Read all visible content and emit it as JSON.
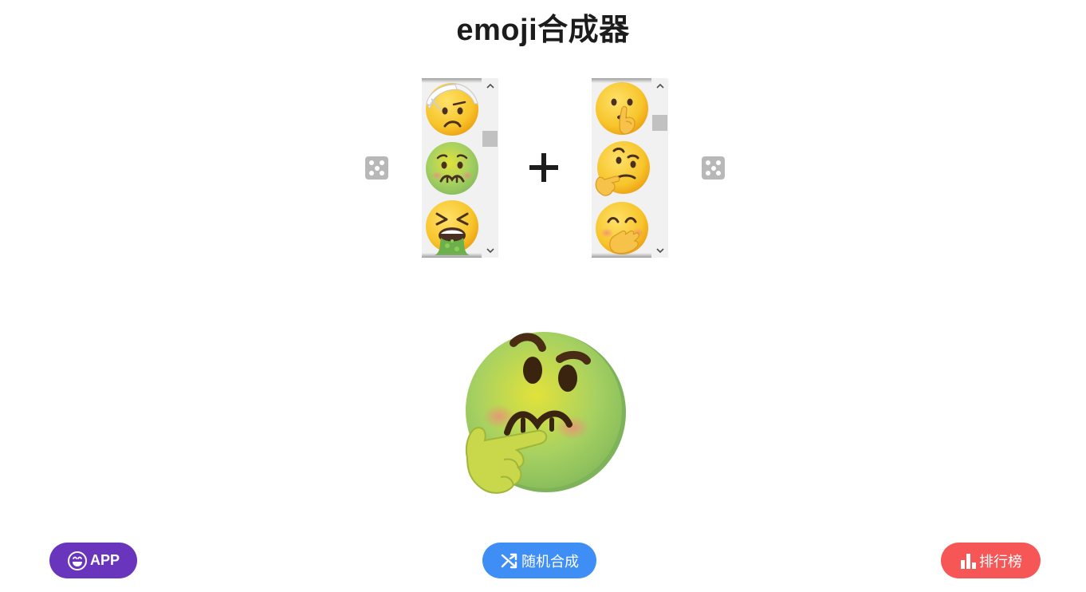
{
  "page": {
    "title": "emoji合成器"
  },
  "picker_left": {
    "items": [
      {
        "icon": "face-with-head-bandage-emoji"
      },
      {
        "icon": "nauseated-face-emoji"
      },
      {
        "icon": "face-vomiting-emoji"
      }
    ]
  },
  "picker_right": {
    "items": [
      {
        "icon": "shushing-face-emoji"
      },
      {
        "icon": "thinking-face-emoji"
      },
      {
        "icon": "face-with-hand-over-mouth-emoji"
      }
    ]
  },
  "operator": {
    "icon": "plus-icon"
  },
  "dice": {
    "icon": "dice-icon"
  },
  "result": {
    "icon": "nauseated-thinking-face-emoji"
  },
  "buttons": {
    "app": {
      "icon": "smiley-icon",
      "label": "APP",
      "color": "#6a35bd"
    },
    "random": {
      "icon": "shuffle-icon",
      "label": "随机合成",
      "color": "#3f8ef5"
    },
    "rank": {
      "icon": "bar-chart-icon",
      "label": "排行榜",
      "color": "#f75656"
    }
  }
}
